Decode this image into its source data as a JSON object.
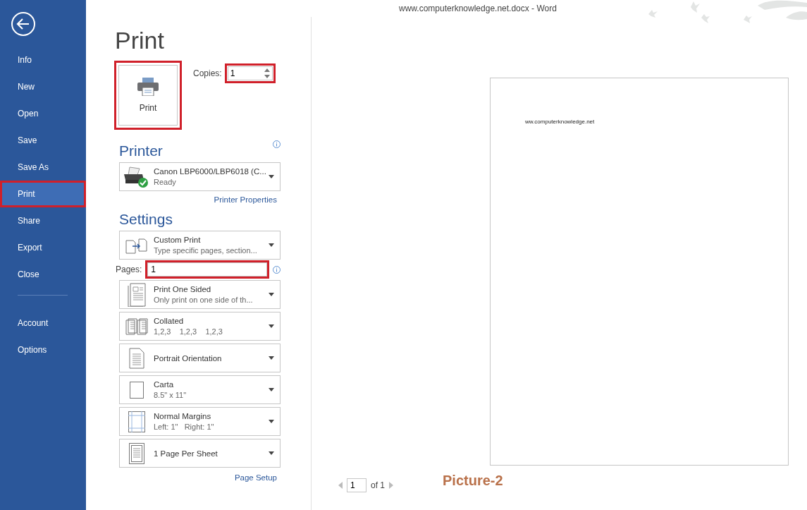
{
  "window": {
    "title": "www.computerknowledge.net.docx - Word"
  },
  "sidebar": {
    "items": [
      {
        "label": "Info",
        "selected": false,
        "highlighted": false
      },
      {
        "label": "New",
        "selected": false,
        "highlighted": false
      },
      {
        "label": "Open",
        "selected": false,
        "highlighted": false
      },
      {
        "label": "Save",
        "selected": false,
        "highlighted": false
      },
      {
        "label": "Save As",
        "selected": false,
        "highlighted": false
      },
      {
        "label": "Print",
        "selected": true,
        "highlighted": true
      },
      {
        "label": "Share",
        "selected": false,
        "highlighted": false
      },
      {
        "label": "Export",
        "selected": false,
        "highlighted": false
      },
      {
        "label": "Close",
        "selected": false,
        "highlighted": false
      }
    ],
    "bottom_items": [
      {
        "label": "Account",
        "selected": false,
        "highlighted": false
      },
      {
        "label": "Options",
        "selected": false,
        "highlighted": false
      }
    ]
  },
  "heading": "Print",
  "print_button": {
    "label": "Print",
    "highlighted": true
  },
  "copies": {
    "label": "Copies:",
    "value": "1",
    "highlighted": true
  },
  "printer": {
    "heading": "Printer",
    "name": "Canon LBP6000/LBP6018 (C...",
    "status": "Ready",
    "link": "Printer Properties"
  },
  "settings": {
    "heading": "Settings",
    "items": [
      {
        "kind": "custom",
        "title": "Custom Print",
        "subtitle": "Type specific pages, section..."
      },
      {
        "kind": "pages",
        "label": "Pages:",
        "value": "1",
        "highlighted": true
      },
      {
        "kind": "sides",
        "title": "Print One Sided",
        "subtitle": "Only print on one side of th..."
      },
      {
        "kind": "collate",
        "title": "Collated",
        "subtitle": "1,2,3    1,2,3    1,2,3"
      },
      {
        "kind": "orientation",
        "title": "Portrait Orientation"
      },
      {
        "kind": "paper",
        "title": "Carta",
        "subtitle": "8.5\" x 11\""
      },
      {
        "kind": "margins",
        "title": "Normal Margins",
        "subtitle": "Left: 1\"   Right: 1\""
      },
      {
        "kind": "persheet",
        "title": "1 Page Per Sheet"
      }
    ],
    "link": "Page Setup"
  },
  "preview": {
    "page_text": "ww.computerknowledge.net",
    "page_number": "1",
    "page_total": "of 1"
  },
  "caption": "Picture-2"
}
